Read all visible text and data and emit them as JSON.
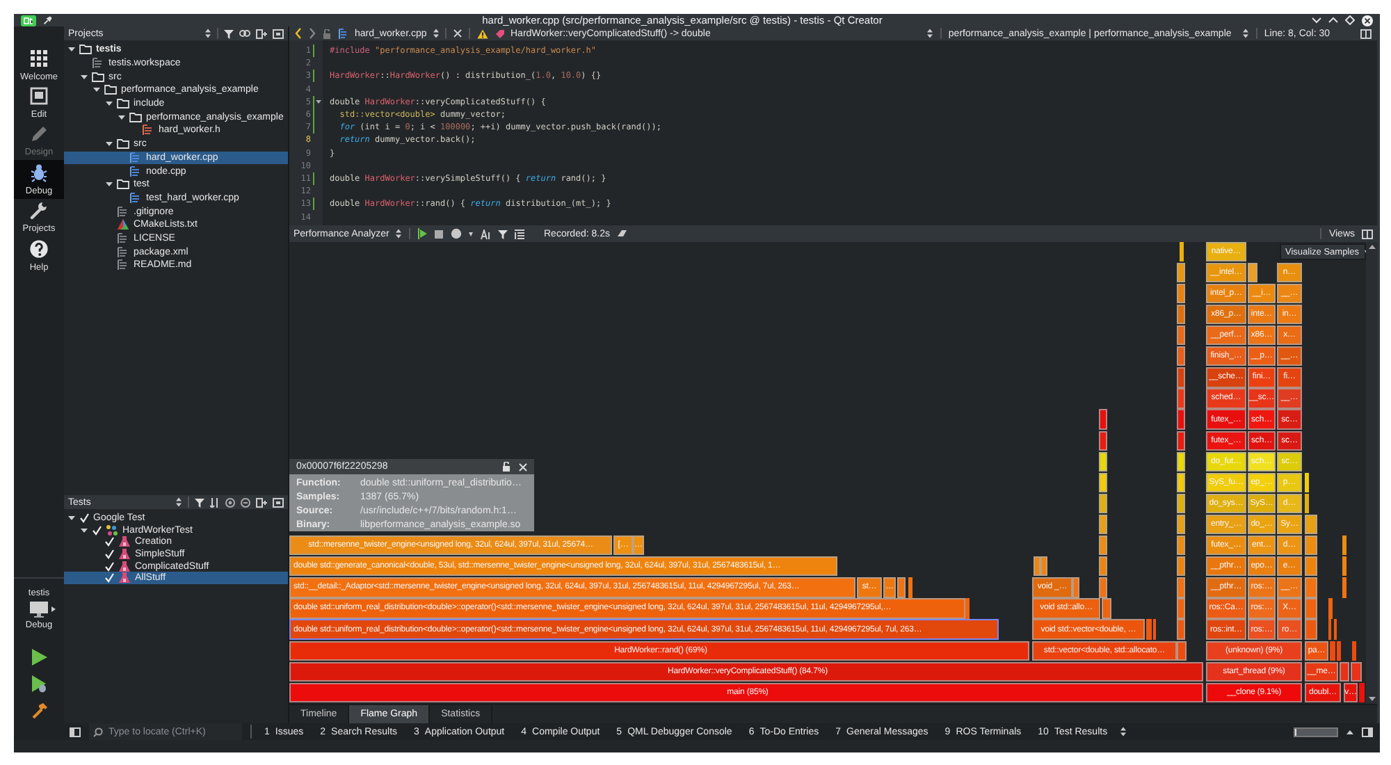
{
  "window": {
    "title": "hard_worker.cpp (src/performance_analysis_example/src @ testis) - testis - Qt Creator"
  },
  "mode_bar": {
    "modes": [
      {
        "label": "Welcome",
        "kind": "welcome",
        "selected": false,
        "disabled": false
      },
      {
        "label": "Edit",
        "kind": "edit",
        "selected": false,
        "disabled": false
      },
      {
        "label": "Design",
        "kind": "design",
        "selected": false,
        "disabled": true
      },
      {
        "label": "Debug",
        "kind": "debug",
        "selected": true,
        "disabled": false
      },
      {
        "label": "Projects",
        "kind": "projects",
        "selected": false,
        "disabled": false
      },
      {
        "label": "Help",
        "kind": "help",
        "selected": false,
        "disabled": false
      }
    ],
    "kit": {
      "project": "testis",
      "build": "Debug"
    }
  },
  "projects": {
    "title": "Projects",
    "tree": [
      {
        "label": "testis",
        "kind": "project",
        "selected": false,
        "expanded": true,
        "children": [
          {
            "label": "testis.workspace",
            "kind": "file",
            "selected": false
          },
          {
            "label": "src",
            "kind": "folder",
            "selected": false,
            "expanded": true,
            "children": [
              {
                "label": "performance_analysis_example",
                "kind": "folder",
                "selected": false,
                "expanded": true,
                "children": [
                  {
                    "label": "include",
                    "kind": "folder",
                    "selected": false,
                    "expanded": true,
                    "children": [
                      {
                        "label": "performance_analysis_example",
                        "kind": "folder",
                        "selected": false,
                        "expanded": true,
                        "children": [
                          {
                            "label": "hard_worker.h",
                            "kind": "header",
                            "selected": false
                          }
                        ]
                      }
                    ]
                  },
                  {
                    "label": "src",
                    "kind": "folder",
                    "selected": false,
                    "expanded": true,
                    "children": [
                      {
                        "label": "hard_worker.cpp",
                        "kind": "source",
                        "selected": true
                      },
                      {
                        "label": "node.cpp",
                        "kind": "source",
                        "selected": false
                      }
                    ]
                  },
                  {
                    "label": "test",
                    "kind": "folder",
                    "selected": false,
                    "expanded": true,
                    "children": [
                      {
                        "label": "test_hard_worker.cpp",
                        "kind": "source",
                        "selected": false
                      }
                    ]
                  },
                  {
                    "label": ".gitignore",
                    "kind": "file",
                    "selected": false
                  },
                  {
                    "label": "CMakeLists.txt",
                    "kind": "cmake",
                    "selected": false
                  },
                  {
                    "label": "LICENSE",
                    "kind": "file",
                    "selected": false
                  },
                  {
                    "label": "package.xml",
                    "kind": "file",
                    "selected": false
                  },
                  {
                    "label": "README.md",
                    "kind": "file",
                    "selected": false
                  }
                ]
              }
            ]
          }
        ]
      }
    ]
  },
  "tests": {
    "title": "Tests",
    "tree": [
      {
        "label": "Google Test",
        "checked": true,
        "selected": false,
        "expanded": true,
        "children": [
          {
            "label": "HardWorkerTest",
            "kind": "suite",
            "checked": true,
            "selected": false,
            "expanded": true,
            "children": [
              {
                "label": "Creation",
                "kind": "test",
                "checked": true,
                "selected": false
              },
              {
                "label": "SimpleStuff",
                "kind": "test",
                "checked": true,
                "selected": false
              },
              {
                "label": "ComplicatedStuff",
                "kind": "test",
                "checked": true,
                "selected": false
              },
              {
                "label": "AllStuff",
                "kind": "test",
                "checked": true,
                "selected": true
              }
            ]
          }
        ]
      }
    ]
  },
  "editor": {
    "file": "hard_worker.cpp",
    "symbol": "HardWorker::veryComplicatedStuff() -> double",
    "context": "performance_analysis_example | performance_analysis_example",
    "position": "Line: 8, Col: 30",
    "lines": [
      {
        "number": "1",
        "current": false,
        "changed": true,
        "foldable": false,
        "tokens": [
          {
            "text": "#include ",
            "kind": "preproc"
          },
          {
            "text": "\"performance_analysis_example/hard_worker.h\"",
            "kind": "string"
          }
        ]
      },
      {
        "number": "2",
        "current": false,
        "changed": false,
        "foldable": false
      },
      {
        "number": "3",
        "current": false,
        "changed": true,
        "foldable": false,
        "tokens": [
          {
            "text": "HardWorker",
            "kind": "type"
          },
          {
            "text": "::",
            "kind": "plain"
          },
          {
            "text": "HardWorker",
            "kind": "type"
          },
          {
            "text": "() : distribution_(",
            "kind": "plain"
          },
          {
            "text": "1.0",
            "kind": "number"
          },
          {
            "text": ", ",
            "kind": "plain"
          },
          {
            "text": "10.0",
            "kind": "number"
          },
          {
            "text": ") {}",
            "kind": "plain"
          }
        ]
      },
      {
        "number": "4",
        "current": false,
        "changed": false,
        "foldable": false
      },
      {
        "number": "5",
        "current": false,
        "changed": true,
        "foldable": true,
        "tokens": [
          {
            "text": "double ",
            "kind": "plain"
          },
          {
            "text": "HardWorker",
            "kind": "type"
          },
          {
            "text": "::veryComplicatedStuff() {",
            "kind": "plain"
          }
        ]
      },
      {
        "number": "6",
        "current": false,
        "changed": true,
        "foldable": false,
        "tokens": [
          {
            "text": "  std::vector<double>",
            "kind": "template"
          },
          {
            "text": " dummy_vector;",
            "kind": "plain"
          }
        ]
      },
      {
        "number": "7",
        "current": false,
        "changed": true,
        "foldable": false,
        "tokens": [
          {
            "text": "  for",
            "kind": "keyword"
          },
          {
            "text": " (int i = ",
            "kind": "plain"
          },
          {
            "text": "0",
            "kind": "number"
          },
          {
            "text": "; i < ",
            "kind": "plain"
          },
          {
            "text": "100000",
            "kind": "number"
          },
          {
            "text": "; ++i) dummy_vector.push_back(rand());",
            "kind": "plain"
          }
        ]
      },
      {
        "number": "8",
        "current": true,
        "changed": false,
        "foldable": false,
        "tokens": [
          {
            "text": "  return",
            "kind": "keyword"
          },
          {
            "text": " dummy_vector.back();",
            "kind": "plain"
          }
        ]
      },
      {
        "number": "9",
        "current": false,
        "changed": false,
        "foldable": false,
        "tokens": [
          {
            "text": "}",
            "kind": "plain"
          }
        ]
      },
      {
        "number": "10",
        "current": false,
        "changed": false,
        "foldable": false
      },
      {
        "number": "11",
        "current": false,
        "changed": true,
        "foldable": false,
        "tokens": [
          {
            "text": "double ",
            "kind": "plain"
          },
          {
            "text": "HardWorker",
            "kind": "type"
          },
          {
            "text": "::verySimpleStuff() { ",
            "kind": "plain"
          },
          {
            "text": "return",
            "kind": "keyword"
          },
          {
            "text": " rand(); }",
            "kind": "plain"
          }
        ]
      },
      {
        "number": "12",
        "current": false,
        "changed": false,
        "foldable": false
      },
      {
        "number": "13",
        "current": false,
        "changed": true,
        "foldable": false,
        "tokens": [
          {
            "text": "double ",
            "kind": "plain"
          },
          {
            "text": "HardWorker",
            "kind": "type"
          },
          {
            "text": "::rand() { ",
            "kind": "plain"
          },
          {
            "text": "return",
            "kind": "keyword"
          },
          {
            "text": " distribution_(mt_); }",
            "kind": "plain"
          }
        ]
      },
      {
        "number": "14",
        "current": false,
        "changed": false,
        "foldable": false
      }
    ]
  },
  "analyzer": {
    "tool": "Performance Analyzer",
    "recorded": "Recorded: 8.2s",
    "views": "Views",
    "visualize": "Visualize Samples",
    "tooltip": {
      "title": "0x00007f6f22205298",
      "rows": [
        {
          "label": "Function:",
          "value": "double std::uniform_real_distributio…"
        },
        {
          "label": "Samples:",
          "value": "1387 (65.7%)"
        },
        {
          "label": "Source:",
          "value": "/usr/include/c++/7/bits/random.h:1…"
        },
        {
          "label": "Binary:",
          "value": "libperformance_analysis_example.so"
        }
      ]
    },
    "flame_graph": {
      "rows": [
        {
          "blocks": [
            {
              "color": "#e8b010",
              "selected": false
            },
            {
              "label": "native…",
              "color": "#e8b010",
              "selected": false
            }
          ]
        },
        {
          "blocks": [
            {
              "color": "#e8960e",
              "selected": false
            },
            {
              "label": "__intel…",
              "color": "#e8960e",
              "selected": false
            },
            {
              "color": "#eaa024",
              "selected": false
            },
            {
              "label": "n…",
              "color": "#e8900e",
              "selected": false
            }
          ]
        },
        {
          "blocks": [
            {
              "color": "#e8820e",
              "selected": false
            },
            {
              "label": "intel_p…",
              "color": "#e8820e",
              "selected": false
            },
            {
              "label": "__i…",
              "color": "#ec8a10",
              "selected": false
            },
            {
              "label": "__…",
              "color": "#ec8612",
              "selected": false
            }
          ]
        },
        {
          "blocks": [
            {
              "color": "#e0700e",
              "selected": false
            },
            {
              "label": "x86_p…",
              "color": "#e0700e",
              "selected": false
            },
            {
              "label": "inte…",
              "color": "#ec7a14",
              "selected": false
            },
            {
              "label": "in…",
              "color": "#ee7a12",
              "selected": false
            }
          ]
        },
        {
          "blocks": [
            {
              "color": "#ea6a18",
              "selected": false
            },
            {
              "label": "__perf…",
              "color": "#ea6a18",
              "selected": false
            },
            {
              "label": "x86…",
              "color": "#ee7416",
              "selected": false
            },
            {
              "label": "x…",
              "color": "#ea6c14",
              "selected": false
            }
          ]
        },
        {
          "blocks": [
            {
              "color": "#e85e1a",
              "selected": false
            },
            {
              "label": "finish_…",
              "color": "#e85e1a",
              "selected": false
            },
            {
              "label": "__p…",
              "color": "#ec5e16",
              "selected": false
            },
            {
              "label": "__…",
              "color": "#e05810",
              "selected": false
            }
          ]
        },
        {
          "blocks": [
            {
              "color": "#d8420e",
              "selected": false
            },
            {
              "label": "__sche…",
              "color": "#d8420e",
              "selected": false
            },
            {
              "label": "fini…",
              "color": "#ec4012",
              "selected": false
            },
            {
              "label": "fi…",
              "color": "#e44410",
              "selected": false
            }
          ]
        },
        {
          "blocks": [
            {
              "color": "#e83a1a",
              "selected": false
            },
            {
              "label": "sched…",
              "color": "#e83a1a",
              "selected": false
            },
            {
              "label": "__sc…",
              "color": "#e83418",
              "selected": false
            },
            {
              "label": "__…",
              "color": "#e03c22",
              "selected": false
            }
          ]
        },
        {
          "blocks": [
            {
              "color": "#e8100e",
              "selected": false
            },
            {
              "color": "#e8100e",
              "selected": false
            },
            {
              "label": "futex_…",
              "color": "#e8100e",
              "selected": false
            },
            {
              "label": "sch…",
              "color": "#ee1810",
              "selected": false
            },
            {
              "label": "sc…",
              "color": "#d81e14",
              "selected": false
            }
          ]
        },
        {
          "blocks": [
            {
              "color": "#e81c10",
              "selected": false
            },
            {
              "color": "#e81c10",
              "selected": false
            },
            {
              "label": "futex_…",
              "color": "#ea1410",
              "selected": false
            },
            {
              "label": "sch…",
              "color": "#e01410",
              "selected": false
            },
            {
              "label": "sc…",
              "color": "#d81a14",
              "selected": false
            }
          ]
        },
        {
          "blocks": [
            {
              "color": "#e8d80a",
              "selected": false
            },
            {
              "color": "#e8d80a",
              "selected": false
            },
            {
              "label": "do_fut…",
              "color": "#e8d80a",
              "selected": false
            },
            {
              "label": "sch…",
              "color": "#f0e020",
              "selected": false
            },
            {
              "label": "sc…",
              "color": "#dccc0a",
              "selected": false
            }
          ]
        },
        {
          "blocks": [
            {
              "color": "#f0cc0a",
              "selected": false
            },
            {
              "color": "#f0cc0a",
              "selected": false
            },
            {
              "label": "SyS_fu…",
              "color": "#f0cc0a",
              "selected": false
            },
            {
              "label": "ep_…",
              "color": "#f4d00a",
              "selected": false
            },
            {
              "label": "p…",
              "color": "#e8c810",
              "selected": false
            },
            {
              "color": "#f0cc0a",
              "selected": false
            }
          ]
        },
        {
          "blocks": [
            {
              "color": "#e0b010",
              "selected": false
            },
            {
              "color": "#e0b010",
              "selected": false
            },
            {
              "label": "do_sys…",
              "color": "#e0b010",
              "selected": false
            },
            {
              "label": "SyS…",
              "color": "#deae0c",
              "selected": false
            },
            {
              "label": "d…",
              "color": "#e8b818",
              "selected": false
            },
            {
              "color": "#e0b010",
              "selected": false
            }
          ]
        },
        {
          "blocks": [
            {
              "color": "#e8a014",
              "selected": false
            },
            {
              "color": "#e8a014",
              "selected": false
            },
            {
              "label": "entry_…",
              "color": "#e8a014",
              "selected": false
            },
            {
              "label": "do_…",
              "color": "#eaa412",
              "selected": false
            },
            {
              "label": "Sy…",
              "color": "#eaa412",
              "selected": false
            },
            {
              "color": "#e8a014",
              "selected": false
            }
          ]
        },
        {
          "blocks": [
            {
              "label": "std::mersenne_twister_engine<unsigned long, 32ul, 624ul, 397ul, 31ul, 25674…",
              "color": "#ea8c16",
              "selected": false
            },
            {
              "label": "[…",
              "color": "#ee9012",
              "selected": false
            },
            {
              "label": "…",
              "color": "#ee9012",
              "selected": false
            },
            {
              "color": "#ec8c10",
              "selected": false
            },
            {
              "color": "#ec8c10",
              "selected": false
            },
            {
              "label": "futex_…",
              "color": "#ea8e12",
              "selected": false
            },
            {
              "label": "ent…",
              "color": "#ec9414",
              "selected": false
            },
            {
              "label": "d…",
              "color": "#ec9414",
              "selected": false
            },
            {
              "color": "#ec8c10",
              "selected": false
            },
            {
              "color": "#ec8c10",
              "selected": false
            }
          ]
        },
        {
          "blocks": [
            {
              "label": "double std::generate_canonical<double, 53ul, std::mersenne_twister_engine<unsigned long, 32ul, 624ul, 397ul, 31ul, 2567483615ul, 1…",
              "color": "#ee840e",
              "selected": false
            },
            {
              "color": "#ee840e",
              "selected": false
            },
            {
              "color": "#ee840e",
              "selected": false
            },
            {
              "color": "#ee840e",
              "selected": false
            },
            {
              "color": "#ee840e",
              "selected": false
            },
            {
              "label": "__pthr…",
              "color": "#e8780e",
              "selected": false
            },
            {
              "label": "epo…",
              "color": "#ea8010",
              "selected": false
            },
            {
              "label": "e…",
              "color": "#ea8010",
              "selected": false
            },
            {
              "color": "#ee840e",
              "selected": false
            },
            {
              "color": "#ee840e",
              "selected": false
            }
          ]
        },
        {
          "blocks": [
            {
              "label": "std::__detail::_Adaptor<std::mersenne_twister_engine<unsigned long, 32ul, 624ul, 397ul, 31ul, 2567483615ul, 11ul, 4294967295ul, 7ul, 263…",
              "color": "#f27010",
              "selected": false
            },
            {
              "label": "st…",
              "color": "#ee7810",
              "selected": false
            },
            {
              "label": "…",
              "color": "#ee7810",
              "selected": false
            },
            {
              "color": "#f07212",
              "selected": false
            },
            {
              "color": "#f07212",
              "selected": false
            },
            {
              "label": "void _…",
              "color": "#e06a0e",
              "selected": false
            },
            {
              "color": "#f07212",
              "selected": false
            },
            {
              "color": "#f07212",
              "selected": false
            },
            {
              "color": "#f07212",
              "selected": false
            },
            {
              "label": "__pthr…",
              "color": "#e26c12",
              "selected": false
            },
            {
              "label": "ros:…",
              "color": "#ec7418",
              "selected": false
            },
            {
              "label": "__…",
              "color": "#ec7418",
              "selected": false
            },
            {
              "color": "#f07212",
              "selected": false
            },
            {
              "color": "#f07212",
              "selected": false
            }
          ]
        },
        {
          "blocks": [
            {
              "label": "double std::uniform_real_distribution<double>::operator()<std::mersenne_twister_engine<unsigned long, 32ul, 624ul, 397ul, 31ul, 2567483615ul, 11ul, 4294967295ul,…",
              "color": "#ee620c",
              "selected": false
            },
            {
              "color": "#ee6410",
              "selected": false
            },
            {
              "label": "void std::allo…",
              "color": "#ec600e",
              "selected": false
            },
            {
              "color": "#ee6410",
              "selected": false
            },
            {
              "color": "#ee6410",
              "selected": false
            },
            {
              "label": "ros::Ca…",
              "color": "#ec5c14",
              "selected": false
            },
            {
              "label": "ros:…",
              "color": "#ee6a1c",
              "selected": false
            },
            {
              "label": "X…",
              "color": "#ec6418",
              "selected": false
            },
            {
              "color": "#ee6410",
              "selected": false
            },
            {
              "color": "#ee6410",
              "selected": false
            }
          ]
        },
        {
          "blocks": [
            {
              "label": "double std::uniform_real_distribution<double>::operator()<std::mersenne_twister_engine<unsigned long, 32ul, 624ul, 397ul, 31ul, 2567483615ul, 11ul, 4294967295ul, 7ul, 263…",
              "color": "#e2480c",
              "selected": true
            },
            {
              "label": "void std::vector<double, …",
              "color": "#ec560c",
              "selected": false
            },
            {
              "color": "#ec5a10",
              "selected": false
            },
            {
              "color": "#ec5a10",
              "selected": false
            },
            {
              "color": "#ec5a10",
              "selected": false
            },
            {
              "label": "ros::int…",
              "color": "#e0460e",
              "selected": false
            },
            {
              "label": "ros:…",
              "color": "#ea5020",
              "selected": false
            },
            {
              "label": "ro…",
              "color": "#ea5020",
              "selected": false
            },
            {
              "color": "#ec5a10",
              "selected": false
            },
            {
              "color": "#ec5a10",
              "selected": false
            },
            {
              "color": "#ec5a10",
              "selected": false
            }
          ]
        },
        {
          "blocks": [
            {
              "label": "HardWorker::rand() (69%)",
              "color": "#e82c0a",
              "selected": false
            },
            {
              "label": "std::vector<double, std::allocato…",
              "color": "#ea420e",
              "selected": false
            },
            {
              "color": "#ec4c10",
              "selected": false
            },
            {
              "label": "(unknown) (9%)",
              "color": "#e8401c",
              "selected": false
            },
            {
              "label": "pa…",
              "color": "#ec5412",
              "selected": false
            },
            {
              "color": "#ec4c10",
              "selected": false
            },
            {
              "color": "#ec4c10",
              "selected": false
            },
            {
              "color": "#ec4c10",
              "selected": false
            }
          ]
        },
        {
          "blocks": [
            {
              "label": "HardWorker::veryComplicatedStuff() (84.7%)",
              "color": "#dc1a0c",
              "selected": false
            },
            {
              "label": "start_thread (9%)",
              "color": "#e4321c",
              "selected": false
            },
            {
              "label": "__me…",
              "color": "#e83a14",
              "selected": false
            },
            {
              "color": "#e8321a",
              "selected": false
            },
            {
              "color": "#e8321a",
              "selected": false
            }
          ]
        },
        {
          "blocks": [
            {
              "label": "main (85%)",
              "color": "#ec0c0c",
              "selected": false
            },
            {
              "label": "__clone (9.1%)",
              "color": "#ee0a0a",
              "selected": false
            },
            {
              "label": "doubl…",
              "color": "#e8140c",
              "selected": false
            },
            {
              "label": "v…",
              "color": "#e8140c",
              "selected": false
            },
            {
              "color": "#e8140c",
              "selected": false
            }
          ]
        }
      ]
    },
    "tabs": [
      {
        "label": "Timeline",
        "selected": false
      },
      {
        "label": "Flame Graph",
        "selected": true
      },
      {
        "label": "Statistics",
        "selected": false
      }
    ]
  },
  "output_bar": {
    "locator_placeholder": "Type to locate (Ctrl+K)",
    "panes": [
      {
        "number": "1",
        "label": "Issues"
      },
      {
        "number": "2",
        "label": "Search Results"
      },
      {
        "number": "3",
        "label": "Application Output"
      },
      {
        "number": "4",
        "label": "Compile Output"
      },
      {
        "number": "5",
        "label": "QML Debugger Console"
      },
      {
        "number": "6",
        "label": "To-Do Entries"
      },
      {
        "number": "7",
        "label": "General Messages"
      },
      {
        "number": "9",
        "label": "ROS Terminals"
      },
      {
        "number": "10",
        "label": "Test Results"
      }
    ],
    "progress": {
      "level": 0.04
    }
  }
}
